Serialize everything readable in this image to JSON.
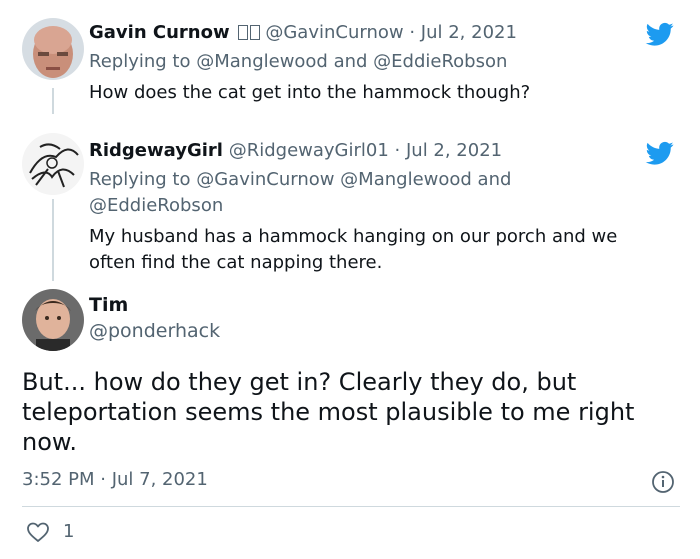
{
  "tweets": [
    {
      "name": "Gavin Curnow",
      "handle": "@GavinCurnow",
      "date": "· Jul 2, 2021",
      "replying_prefix": "Replying to",
      "replying_line1": "@Manglewood and @EddieRobson",
      "text": "How does the cat get into the hammock though?"
    },
    {
      "name": "RidgewayGirl",
      "handle": "@RidgewayGirl01",
      "date": "· Jul 2, 2021",
      "replying_prefix": "Replying to",
      "replying_line1": "@GavinCurnow @Manglewood and",
      "replying_line2": "@EddieRobson",
      "text_line1": "My husband has a hammock hanging on our porch and we",
      "text_line2": "often find the cat napping there."
    }
  ],
  "main_tweet": {
    "name": "Tim",
    "handle": "@ponderhack",
    "text": "But... how do they get in? Clearly they do, but teleportation seems the most plausible to me right now.",
    "timestamp": "3:52 PM · Jul 7, 2021",
    "like_count": "1"
  },
  "colors": {
    "twitter_blue": "#1d9bf0",
    "secondary_text": "#536471",
    "primary_text": "#0f1419",
    "divider": "#cfd9de"
  },
  "icons": [
    "twitter-bird-icon",
    "info-icon",
    "heart-icon"
  ]
}
